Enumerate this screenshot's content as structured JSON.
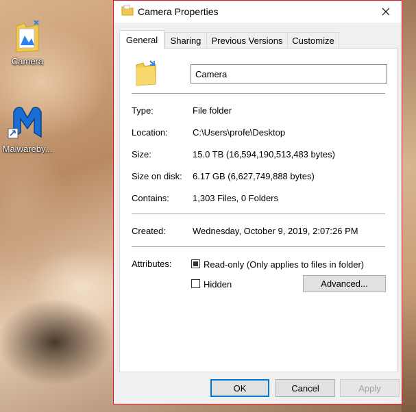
{
  "desktop": {
    "icons": [
      {
        "label": "Camera"
      },
      {
        "label": "Malwareby..."
      }
    ]
  },
  "dialog": {
    "title": "Camera Properties",
    "tabs": [
      "General",
      "Sharing",
      "Previous Versions",
      "Customize"
    ],
    "active_tab": "General",
    "name_value": "Camera",
    "properties": {
      "type_label": "Type:",
      "type_value": "File folder",
      "location_label": "Location:",
      "location_value": "C:\\Users\\profe\\Desktop",
      "size_label": "Size:",
      "size_value": "15.0 TB (16,594,190,513,483 bytes)",
      "size_on_disk_label": "Size on disk:",
      "size_on_disk_value": "6.17 GB (6,627,749,888 bytes)",
      "contains_label": "Contains:",
      "contains_value": "1,303 Files, 0 Folders",
      "created_label": "Created:",
      "created_value": "Wednesday, October 9, 2019, 2:07:26 PM"
    },
    "attributes": {
      "label": "Attributes:",
      "readonly_label": "Read-only (Only applies to files in folder)",
      "readonly_checked": true,
      "hidden_label": "Hidden",
      "hidden_checked": false,
      "advanced_label": "Advanced..."
    },
    "buttons": {
      "ok": "OK",
      "cancel": "Cancel",
      "apply": "Apply"
    }
  }
}
